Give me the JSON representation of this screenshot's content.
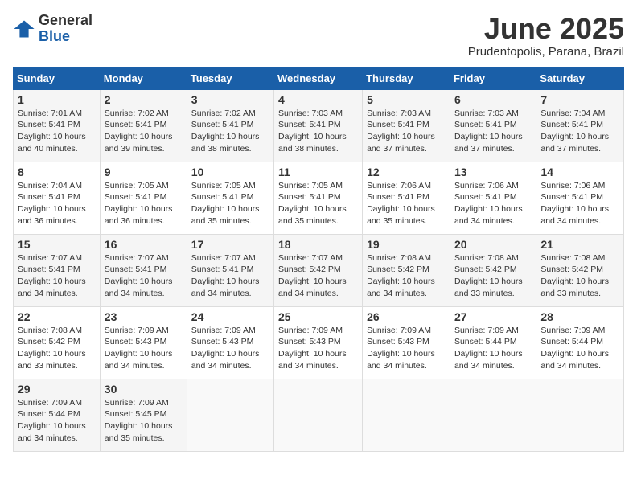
{
  "logo": {
    "general": "General",
    "blue": "Blue"
  },
  "header": {
    "title": "June 2025",
    "subtitle": "Prudentopolis, Parana, Brazil"
  },
  "weekdays": [
    "Sunday",
    "Monday",
    "Tuesday",
    "Wednesday",
    "Thursday",
    "Friday",
    "Saturday"
  ],
  "weeks": [
    [
      {
        "day": "1",
        "sunrise": "7:01 AM",
        "sunset": "5:41 PM",
        "daylight": "10 hours and 40 minutes."
      },
      {
        "day": "2",
        "sunrise": "7:02 AM",
        "sunset": "5:41 PM",
        "daylight": "10 hours and 39 minutes."
      },
      {
        "day": "3",
        "sunrise": "7:02 AM",
        "sunset": "5:41 PM",
        "daylight": "10 hours and 38 minutes."
      },
      {
        "day": "4",
        "sunrise": "7:03 AM",
        "sunset": "5:41 PM",
        "daylight": "10 hours and 38 minutes."
      },
      {
        "day": "5",
        "sunrise": "7:03 AM",
        "sunset": "5:41 PM",
        "daylight": "10 hours and 37 minutes."
      },
      {
        "day": "6",
        "sunrise": "7:03 AM",
        "sunset": "5:41 PM",
        "daylight": "10 hours and 37 minutes."
      },
      {
        "day": "7",
        "sunrise": "7:04 AM",
        "sunset": "5:41 PM",
        "daylight": "10 hours and 37 minutes."
      }
    ],
    [
      {
        "day": "8",
        "sunrise": "7:04 AM",
        "sunset": "5:41 PM",
        "daylight": "10 hours and 36 minutes."
      },
      {
        "day": "9",
        "sunrise": "7:05 AM",
        "sunset": "5:41 PM",
        "daylight": "10 hours and 36 minutes."
      },
      {
        "day": "10",
        "sunrise": "7:05 AM",
        "sunset": "5:41 PM",
        "daylight": "10 hours and 35 minutes."
      },
      {
        "day": "11",
        "sunrise": "7:05 AM",
        "sunset": "5:41 PM",
        "daylight": "10 hours and 35 minutes."
      },
      {
        "day": "12",
        "sunrise": "7:06 AM",
        "sunset": "5:41 PM",
        "daylight": "10 hours and 35 minutes."
      },
      {
        "day": "13",
        "sunrise": "7:06 AM",
        "sunset": "5:41 PM",
        "daylight": "10 hours and 34 minutes."
      },
      {
        "day": "14",
        "sunrise": "7:06 AM",
        "sunset": "5:41 PM",
        "daylight": "10 hours and 34 minutes."
      }
    ],
    [
      {
        "day": "15",
        "sunrise": "7:07 AM",
        "sunset": "5:41 PM",
        "daylight": "10 hours and 34 minutes."
      },
      {
        "day": "16",
        "sunrise": "7:07 AM",
        "sunset": "5:41 PM",
        "daylight": "10 hours and 34 minutes."
      },
      {
        "day": "17",
        "sunrise": "7:07 AM",
        "sunset": "5:41 PM",
        "daylight": "10 hours and 34 minutes."
      },
      {
        "day": "18",
        "sunrise": "7:07 AM",
        "sunset": "5:42 PM",
        "daylight": "10 hours and 34 minutes."
      },
      {
        "day": "19",
        "sunrise": "7:08 AM",
        "sunset": "5:42 PM",
        "daylight": "10 hours and 34 minutes."
      },
      {
        "day": "20",
        "sunrise": "7:08 AM",
        "sunset": "5:42 PM",
        "daylight": "10 hours and 33 minutes."
      },
      {
        "day": "21",
        "sunrise": "7:08 AM",
        "sunset": "5:42 PM",
        "daylight": "10 hours and 33 minutes."
      }
    ],
    [
      {
        "day": "22",
        "sunrise": "7:08 AM",
        "sunset": "5:42 PM",
        "daylight": "10 hours and 33 minutes."
      },
      {
        "day": "23",
        "sunrise": "7:09 AM",
        "sunset": "5:43 PM",
        "daylight": "10 hours and 34 minutes."
      },
      {
        "day": "24",
        "sunrise": "7:09 AM",
        "sunset": "5:43 PM",
        "daylight": "10 hours and 34 minutes."
      },
      {
        "day": "25",
        "sunrise": "7:09 AM",
        "sunset": "5:43 PM",
        "daylight": "10 hours and 34 minutes."
      },
      {
        "day": "26",
        "sunrise": "7:09 AM",
        "sunset": "5:43 PM",
        "daylight": "10 hours and 34 minutes."
      },
      {
        "day": "27",
        "sunrise": "7:09 AM",
        "sunset": "5:44 PM",
        "daylight": "10 hours and 34 minutes."
      },
      {
        "day": "28",
        "sunrise": "7:09 AM",
        "sunset": "5:44 PM",
        "daylight": "10 hours and 34 minutes."
      }
    ],
    [
      {
        "day": "29",
        "sunrise": "7:09 AM",
        "sunset": "5:44 PM",
        "daylight": "10 hours and 34 minutes."
      },
      {
        "day": "30",
        "sunrise": "7:09 AM",
        "sunset": "5:45 PM",
        "daylight": "10 hours and 35 minutes."
      },
      null,
      null,
      null,
      null,
      null
    ]
  ],
  "labels": {
    "sunrise": "Sunrise: ",
    "sunset": "Sunset: ",
    "daylight": "Daylight: "
  }
}
